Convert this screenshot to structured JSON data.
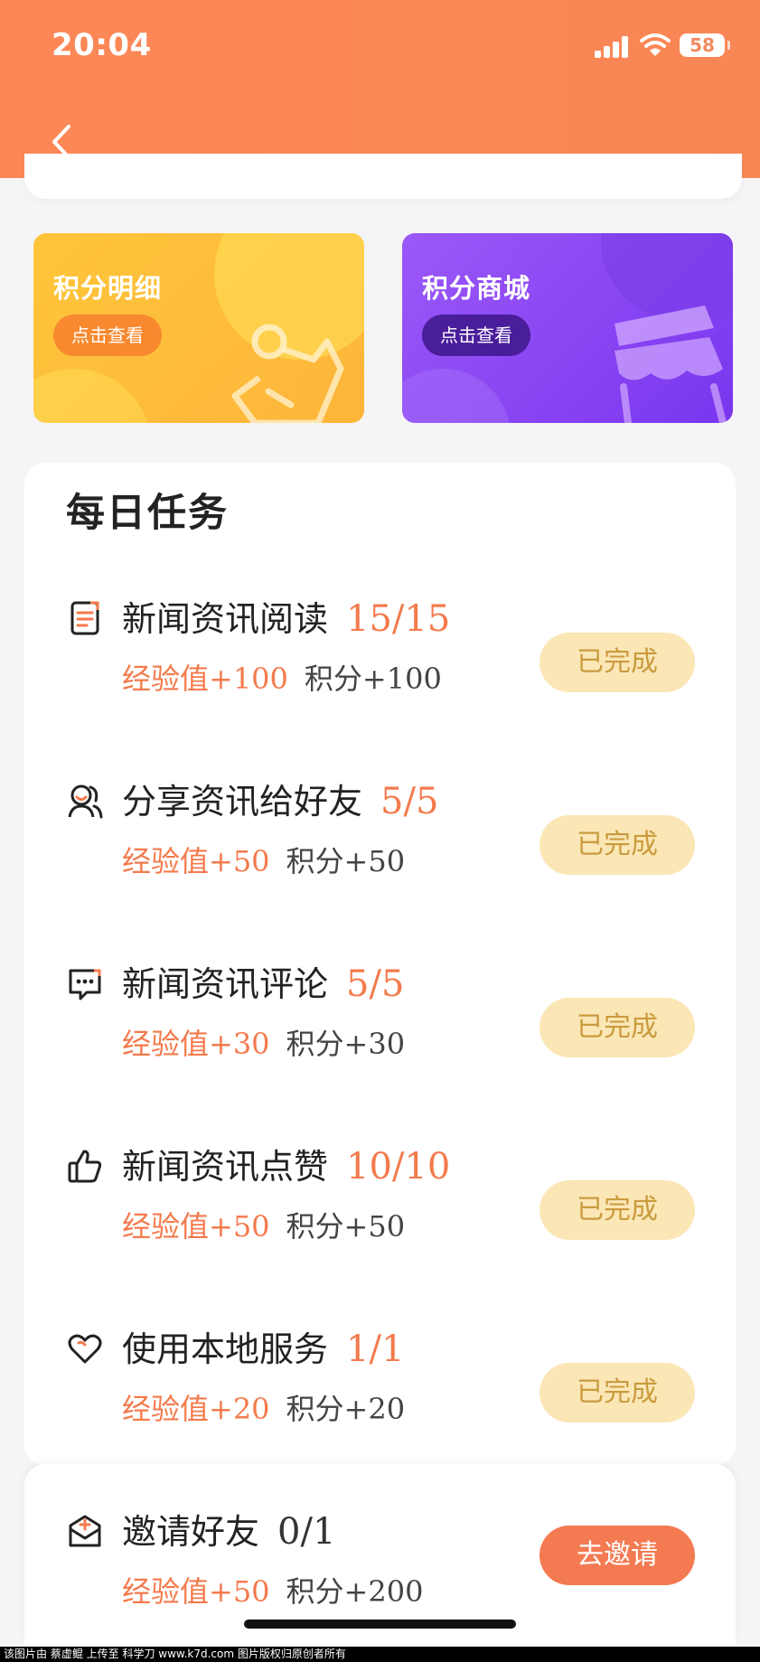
{
  "status_bar": {
    "time": "20:04",
    "battery": "58"
  },
  "promo_cards": [
    {
      "title": "积分明细",
      "button": "点击查看"
    },
    {
      "title": "积分商城",
      "button": "点击查看"
    }
  ],
  "tasks_section": {
    "title": "每日任务",
    "tasks": [
      {
        "name": "新闻资讯阅读",
        "progress": "15/15",
        "exp": "经验值+100",
        "points": "积分+100",
        "button": "已完成",
        "icon": "document-icon"
      },
      {
        "name": "分享资讯给好友",
        "progress": "5/5",
        "exp": "经验值+50",
        "points": "积分+50",
        "button": "已完成",
        "icon": "users-icon"
      },
      {
        "name": "新闻资讯评论",
        "progress": "5/5",
        "exp": "经验值+30",
        "points": "积分+30",
        "button": "已完成",
        "icon": "comment-icon"
      },
      {
        "name": "新闻资讯点赞",
        "progress": "10/10",
        "exp": "经验值+50",
        "points": "积分+50",
        "button": "已完成",
        "icon": "thumbs-up-icon"
      },
      {
        "name": "使用本地服务",
        "progress": "1/1",
        "exp": "经验值+20",
        "points": "积分+20",
        "button": "已完成",
        "icon": "heart-icon"
      }
    ],
    "invite": {
      "name": "邀请好友",
      "progress": "0/1",
      "exp": "经验值+50",
      "points": "积分+200",
      "button": "去邀请",
      "icon": "mail-icon"
    }
  },
  "footer": "该图片由 蔡虚鲲 上传至 科学刀 www.k7d.com 图片版权归原创者所有",
  "colors": {
    "accent": "#f47a4c",
    "header": "#fd8757",
    "done_bg": "#fbe6b6",
    "done_text": "#c99b3d"
  }
}
